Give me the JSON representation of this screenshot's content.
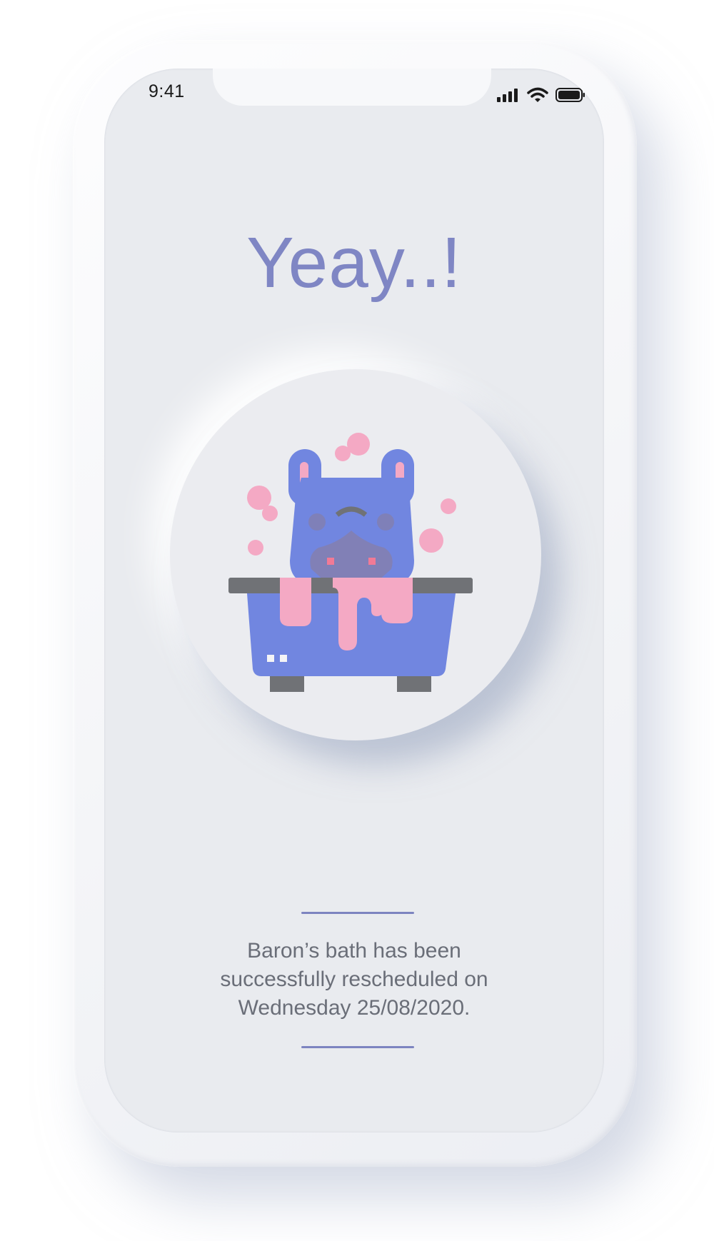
{
  "status_bar": {
    "time": "9:41",
    "icons": [
      "cellular-signal-icon",
      "wifi-icon",
      "battery-icon"
    ]
  },
  "screen": {
    "title": "Yeay..!",
    "illustration": "dog-bath-icon",
    "message_lines": [
      "Baron’s bath has been",
      "successfully rescheduled on",
      "Wednesday 25/08/2020."
    ]
  },
  "colors": {
    "title": "#7f86c4",
    "divider": "#7d84c0",
    "screen_background": "#e9ebef",
    "dog_blue": "#7186e0",
    "bubble_pink": "#f4a9c4",
    "tub_gray": "#707276",
    "message_text": "#6a6e78"
  }
}
